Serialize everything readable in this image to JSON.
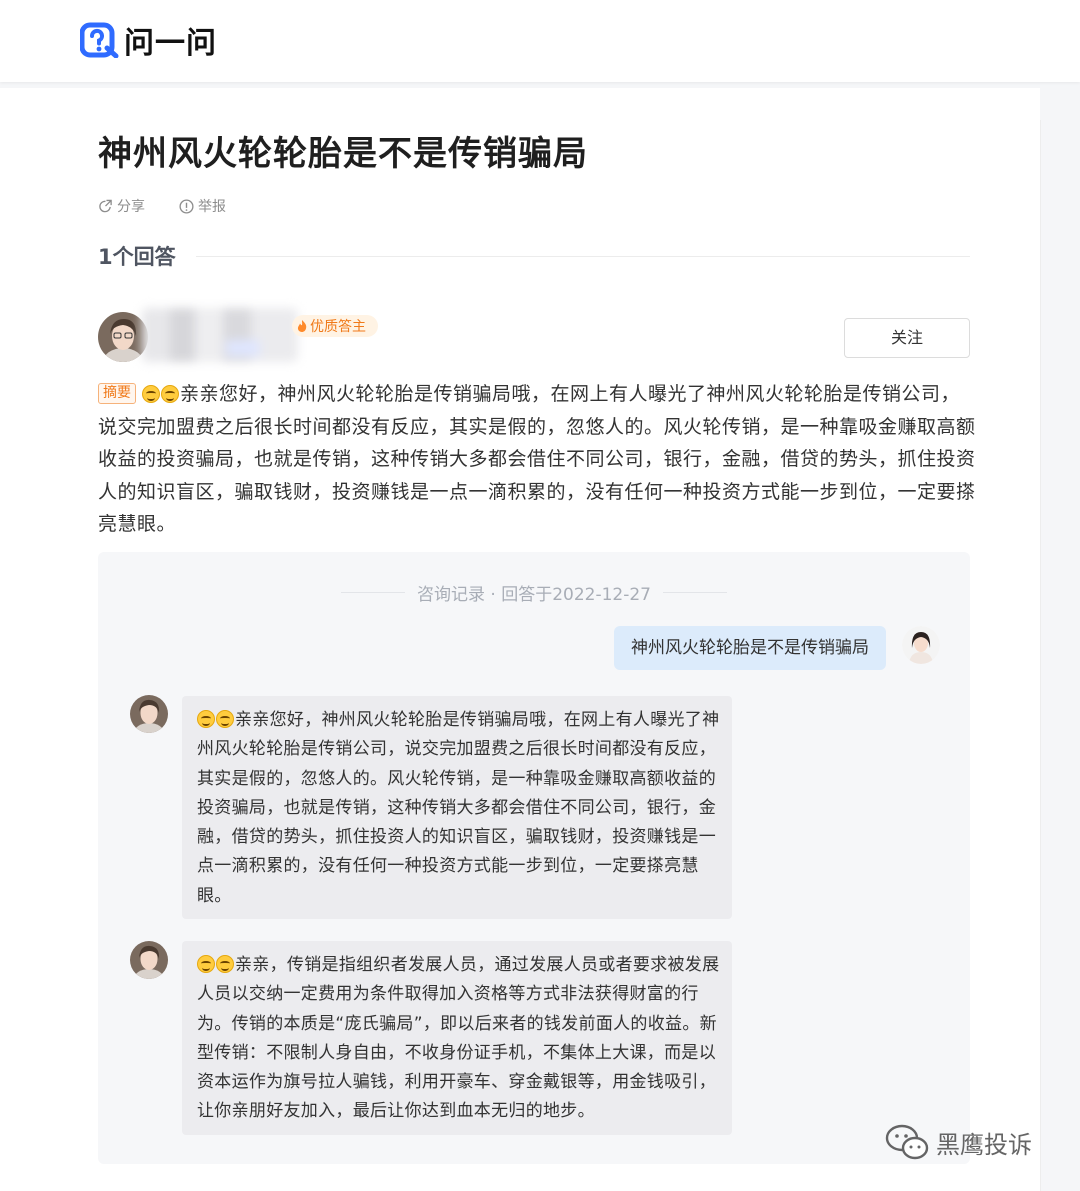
{
  "header": {
    "logo_text": "问一问"
  },
  "question": {
    "title": "神州风火轮轮胎是不是传销骗局",
    "actions": [
      {
        "label": "分享",
        "icon": "share-icon"
      },
      {
        "label": "举报",
        "icon": "report-icon"
      }
    ]
  },
  "answers": {
    "count_label": "1个回答",
    "author": {
      "badge": "优质答主",
      "follow_label": "关注"
    },
    "summary_tag": "摘要",
    "summary_text": "亲亲您好，神州风火轮轮胎是传销骗局哦，在网上有人曝光了神州风火轮轮胎是传销公司，说交完加盟费之后很长时间都没有反应，其实是假的，忽悠人的。风火轮传销，是一种靠吸金赚取高额收益的投资骗局，也就是传销，这种传销大多都会借住不同公司，银行，金融，借贷的势头，抓住投资人的知识盲区，骗取钱财，投资赚钱是一点一滴积累的，没有任何一种投资方式能一步到位，一定要搽亮慧眼。"
  },
  "record": {
    "header": "咨询记录 · 回答于2022-12-27",
    "user_question": "神州风火轮轮胎是不是传销骗局",
    "replies": [
      "亲亲您好，神州风火轮轮胎是传销骗局哦，在网上有人曝光了神州风火轮轮胎是传销公司，说交完加盟费之后很长时间都没有反应，其实是假的，忽悠人的。风火轮传销，是一种靠吸金赚取高额收益的投资骗局，也就是传销，这种传销大多都会借住不同公司，银行，金融，借贷的势头，抓住投资人的知识盲区，骗取钱财，投资赚钱是一点一滴积累的，没有任何一种投资方式能一步到位，一定要搽亮慧眼。",
      "亲亲，传销是指组织者发展人员，通过发展人员或者要求被发展人员以交纳一定费用为条件取得加入资格等方式非法获得财富的行为。传销的本质是“庞氏骗局”，即以后来者的钱发前面人的收益。新型传销：不限制人身自由，不收身份证手机，不集体上大课，而是以资本运作为旗号拉人骗钱，利用开豪车、穿金戴银等，用金钱吸引，让你亲朋好友加入，最后让你达到血本无归的地步。"
    ]
  },
  "watermark": {
    "text": "黑鹰投诉"
  },
  "colors": {
    "accent": "#2f6bff",
    "badge": "#f07a1a",
    "bubble_user": "#dcebfb",
    "bubble_reply": "#ececef"
  }
}
